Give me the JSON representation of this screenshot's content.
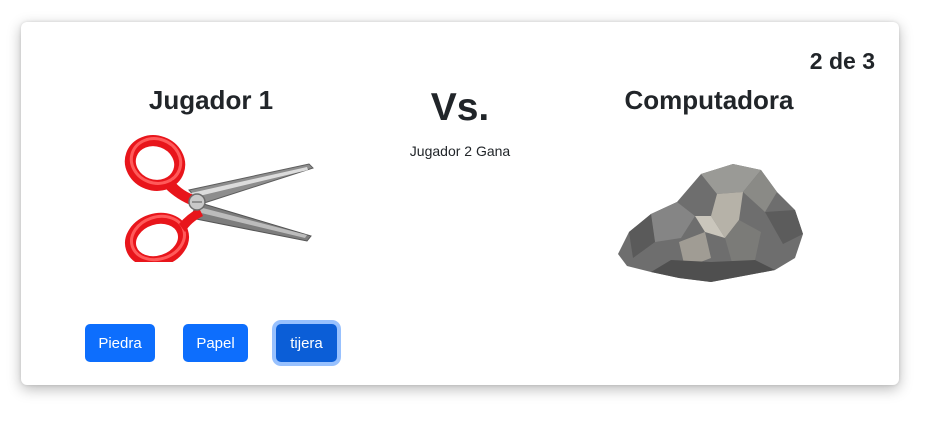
{
  "game": {
    "round_counter": "2 de 3",
    "player_title": "Jugador 1",
    "vs_label": "Vs.",
    "result": "Jugador 2 Gana",
    "computer_title": "Computadora",
    "player_choice_icon": "scissors-icon",
    "computer_choice_icon": "rock-icon"
  },
  "buttons": {
    "piedra": "Piedra",
    "papel": "Papel",
    "tijera": "tijera"
  },
  "colors": {
    "primary_button": "#0d6efd",
    "focused_button": "#0b5ed7",
    "scissors_handle": "#e8151b"
  }
}
